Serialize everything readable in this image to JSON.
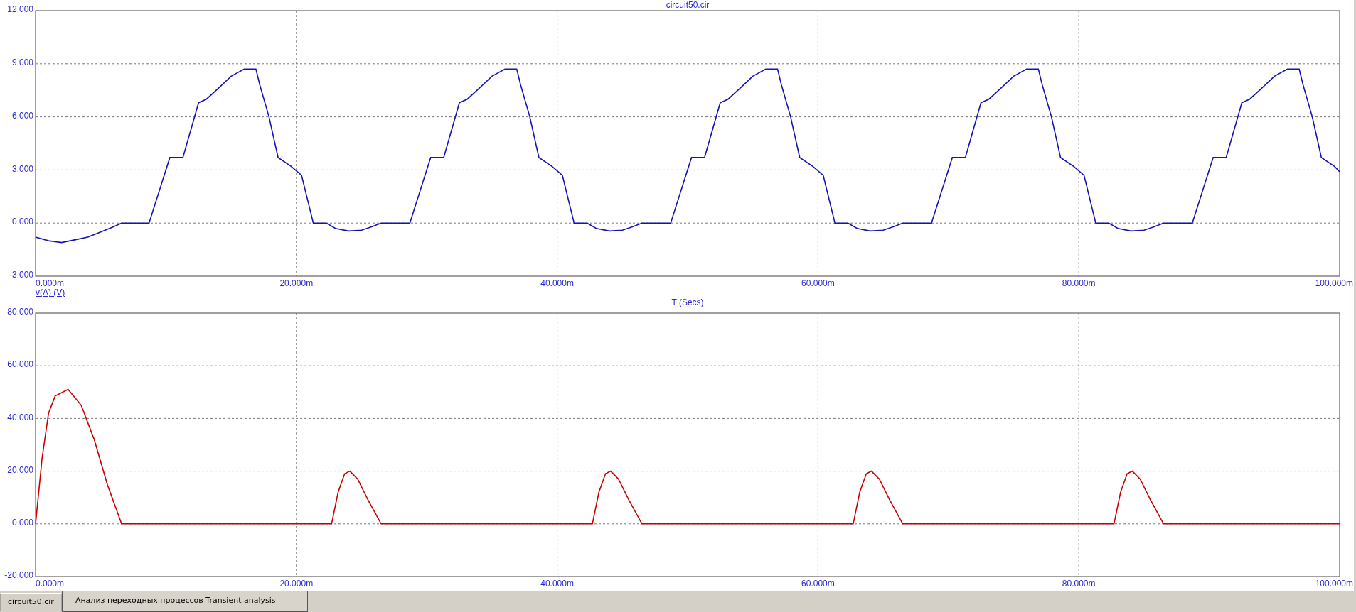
{
  "charts": [
    {
      "chart_data": {
        "type": "line",
        "grid": true,
        "title": "circuit50.cir",
        "xlabel": "T (Secs)",
        "xlim": [
          0,
          100
        ],
        "ylim": [
          -3,
          12
        ],
        "xticks": [
          {
            "value": 0,
            "label": "0.000m"
          },
          {
            "value": 20,
            "label": "20.000m"
          },
          {
            "value": 40,
            "label": "40.000m"
          },
          {
            "value": 60,
            "label": "60.000m"
          },
          {
            "value": 80,
            "label": "80.000m"
          },
          {
            "value": 100,
            "label": "100.000m"
          }
        ],
        "yticks": [
          {
            "value": -3,
            "label": "-3.000"
          },
          {
            "value": 0,
            "label": "0.000"
          },
          {
            "value": 3,
            "label": "3.000"
          },
          {
            "value": 6,
            "label": "6.000"
          },
          {
            "value": 9,
            "label": "9.000"
          },
          {
            "value": 12,
            "label": "12.000"
          }
        ],
        "x": [
          0,
          1,
          2,
          3,
          4,
          5,
          6,
          6.6,
          8.7,
          10.3,
          11.3,
          12.5,
          13.1,
          14,
          15,
          16,
          16.9,
          17.2,
          17.9,
          18.6,
          19.6,
          20.4,
          21.3,
          22.3,
          23,
          24,
          25,
          25.8,
          26.5,
          28.7,
          30.3,
          31.3,
          32.5,
          33.1,
          34,
          35,
          36,
          36.9,
          37.2,
          37.9,
          38.6,
          39.6,
          40.4,
          41.3,
          42.3,
          43,
          44,
          45,
          45.8,
          46.5,
          48.7,
          50.3,
          51.3,
          52.5,
          53.1,
          54,
          55,
          56,
          56.9,
          57.2,
          57.9,
          58.6,
          59.6,
          60.4,
          61.3,
          62.3,
          63,
          64,
          65,
          65.8,
          66.5,
          68.7,
          70.3,
          71.3,
          72.5,
          73.1,
          74,
          75,
          76,
          76.9,
          77.2,
          77.9,
          78.6,
          79.6,
          80.4,
          81.3,
          82.3,
          83,
          84,
          85,
          85.8,
          86.5,
          88.7,
          90.3,
          91.3,
          92.5,
          93.1,
          94,
          95,
          96,
          96.9,
          97.2,
          97.9,
          98.6,
          99.6,
          100
        ],
        "series": [
          {
            "name": "v(A) (V)",
            "color": "#1414b4",
            "values": [
              -0.8,
              -1.0,
              -1.1,
              -0.95,
              -0.8,
              -0.5,
              -0.2,
              0,
              0,
              3.7,
              3.7,
              6.8,
              7.0,
              7.6,
              8.3,
              8.7,
              8.7,
              7.8,
              6.0,
              3.7,
              3.2,
              2.7,
              0,
              0,
              -0.3,
              -0.45,
              -0.4,
              -0.2,
              0,
              0,
              3.7,
              3.7,
              6.8,
              7.0,
              7.6,
              8.3,
              8.7,
              8.7,
              7.8,
              6.0,
              3.7,
              3.2,
              2.7,
              0,
              0,
              -0.3,
              -0.45,
              -0.4,
              -0.2,
              0,
              0,
              3.7,
              3.7,
              6.8,
              7.0,
              7.6,
              8.3,
              8.7,
              8.7,
              7.8,
              6.0,
              3.7,
              3.2,
              2.7,
              0,
              0,
              -0.3,
              -0.45,
              -0.4,
              -0.2,
              0,
              0,
              3.7,
              3.7,
              6.8,
              7.0,
              7.6,
              8.3,
              8.7,
              8.7,
              7.8,
              6.0,
              3.7,
              3.2,
              2.7,
              0,
              0,
              -0.3,
              -0.45,
              -0.4,
              -0.2,
              0,
              0,
              3.7,
              3.7,
              6.8,
              7.0,
              7.6,
              8.3,
              8.7,
              8.7,
              7.8,
              6.0,
              3.7,
              3.2,
              2.9
            ]
          }
        ]
      }
    },
    {
      "chart_data": {
        "type": "line",
        "grid": true,
        "xlim": [
          0,
          100
        ],
        "ylim": [
          -20,
          80
        ],
        "xticks": [
          {
            "value": 0,
            "label": "0.000m"
          },
          {
            "value": 20,
            "label": "20.000m"
          },
          {
            "value": 40,
            "label": "40.000m"
          },
          {
            "value": 60,
            "label": "60.000m"
          },
          {
            "value": 80,
            "label": "80.000m"
          },
          {
            "value": 100,
            "label": "100.000m"
          }
        ],
        "yticks": [
          {
            "value": -20,
            "label": "-20.000"
          },
          {
            "value": 0,
            "label": "0.000"
          },
          {
            "value": 20,
            "label": "20.000"
          },
          {
            "value": 40,
            "label": "40.000"
          },
          {
            "value": 60,
            "label": "60.000"
          },
          {
            "value": 80,
            "label": "80.000"
          }
        ],
        "x": [
          0,
          0.5,
          1,
          1.5,
          2.5,
          3.5,
          4.5,
          5.5,
          6.6,
          22.7,
          23.2,
          23.7,
          24.1,
          24.7,
          25.5,
          26.5,
          42.7,
          43.2,
          43.7,
          44.1,
          44.7,
          45.5,
          46.5,
          62.7,
          63.2,
          63.7,
          64.1,
          64.7,
          65.5,
          66.5,
          82.7,
          83.2,
          83.7,
          84.1,
          84.7,
          85.5,
          86.5,
          100
        ],
        "series": [
          {
            "color": "#c80000",
            "values": [
              0,
              25,
              42,
              48.5,
              51,
              45,
              32,
              15,
              0,
              0,
              12,
              19,
              20,
              17,
              9,
              0,
              0,
              12,
              19,
              20,
              17,
              9,
              0,
              0,
              12,
              19,
              20,
              17,
              9,
              0,
              0,
              12,
              19,
              20,
              17,
              9,
              0,
              0
            ]
          }
        ]
      }
    }
  ],
  "tabs": [
    {
      "label": "circuit50.cir",
      "selected": false
    },
    {
      "label": "Анализ переходных процессов Transient analysis",
      "selected": true
    }
  ]
}
